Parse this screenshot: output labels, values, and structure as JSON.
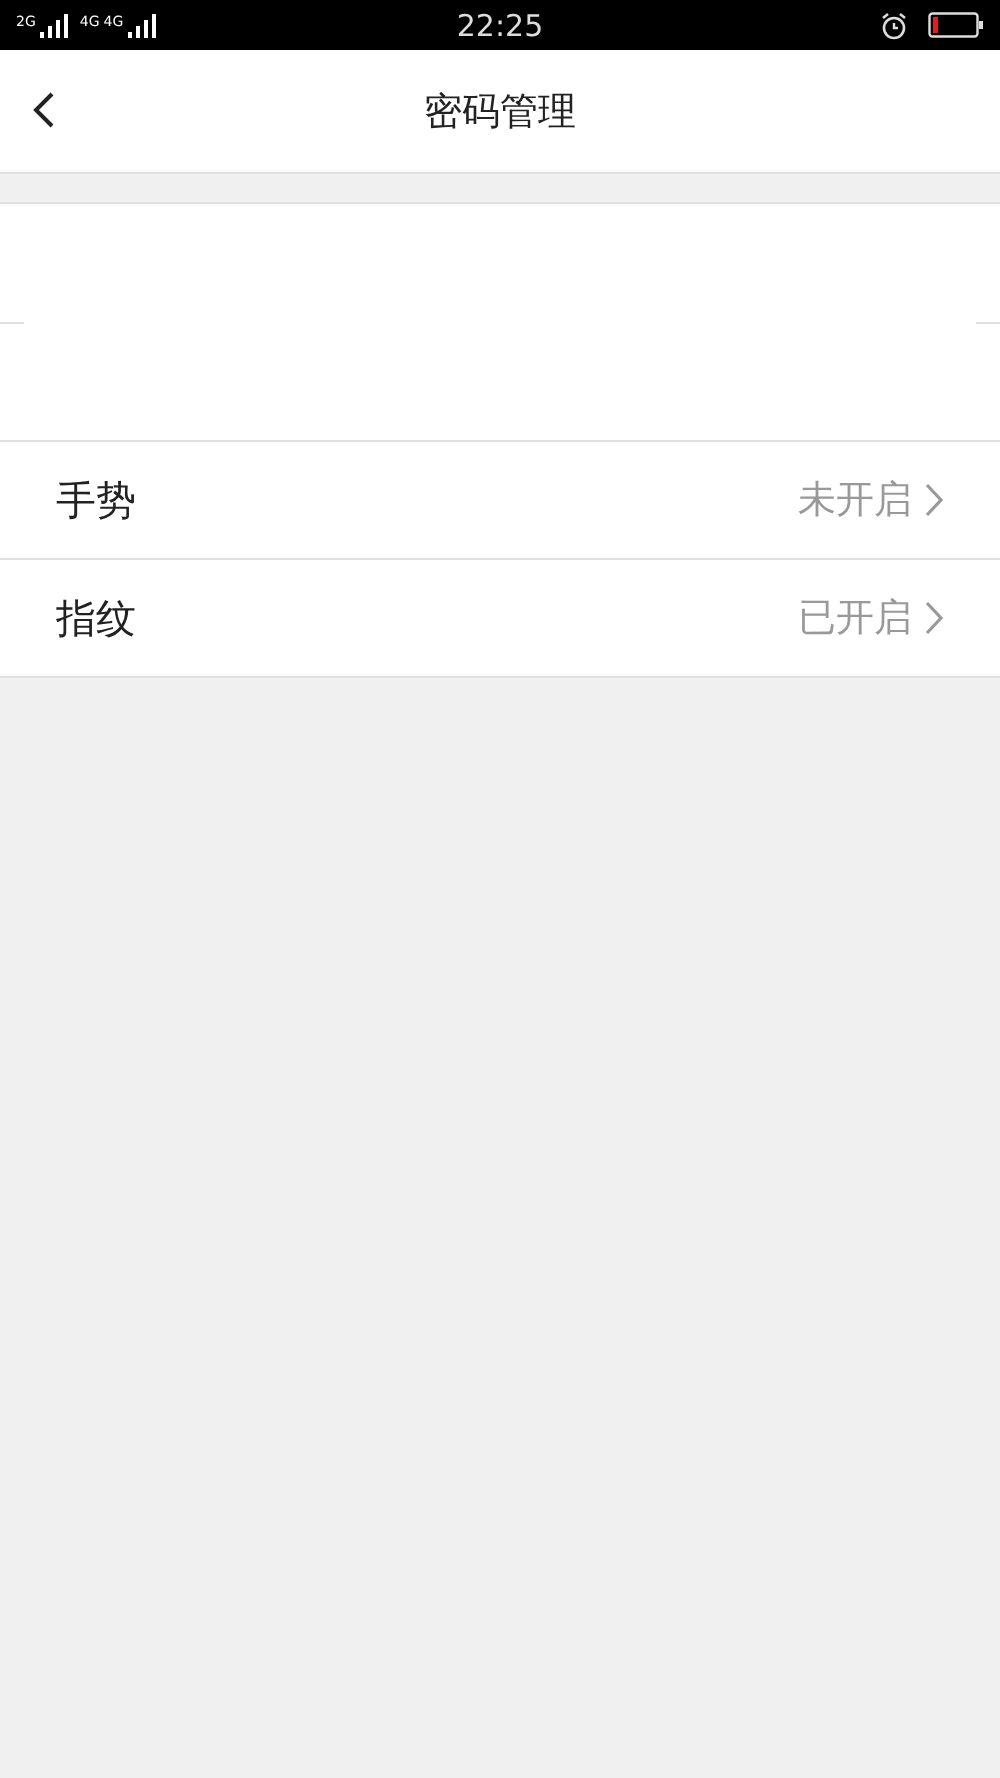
{
  "status_bar": {
    "sim_1_label": "2G",
    "sim_2_labels": [
      "4G",
      "4G"
    ],
    "time": "22:25"
  },
  "header": {
    "title": "密码管理"
  },
  "settings": [
    {
      "label": "手势",
      "value": "未开启"
    },
    {
      "label": "指纹",
      "value": "已开启"
    }
  ]
}
